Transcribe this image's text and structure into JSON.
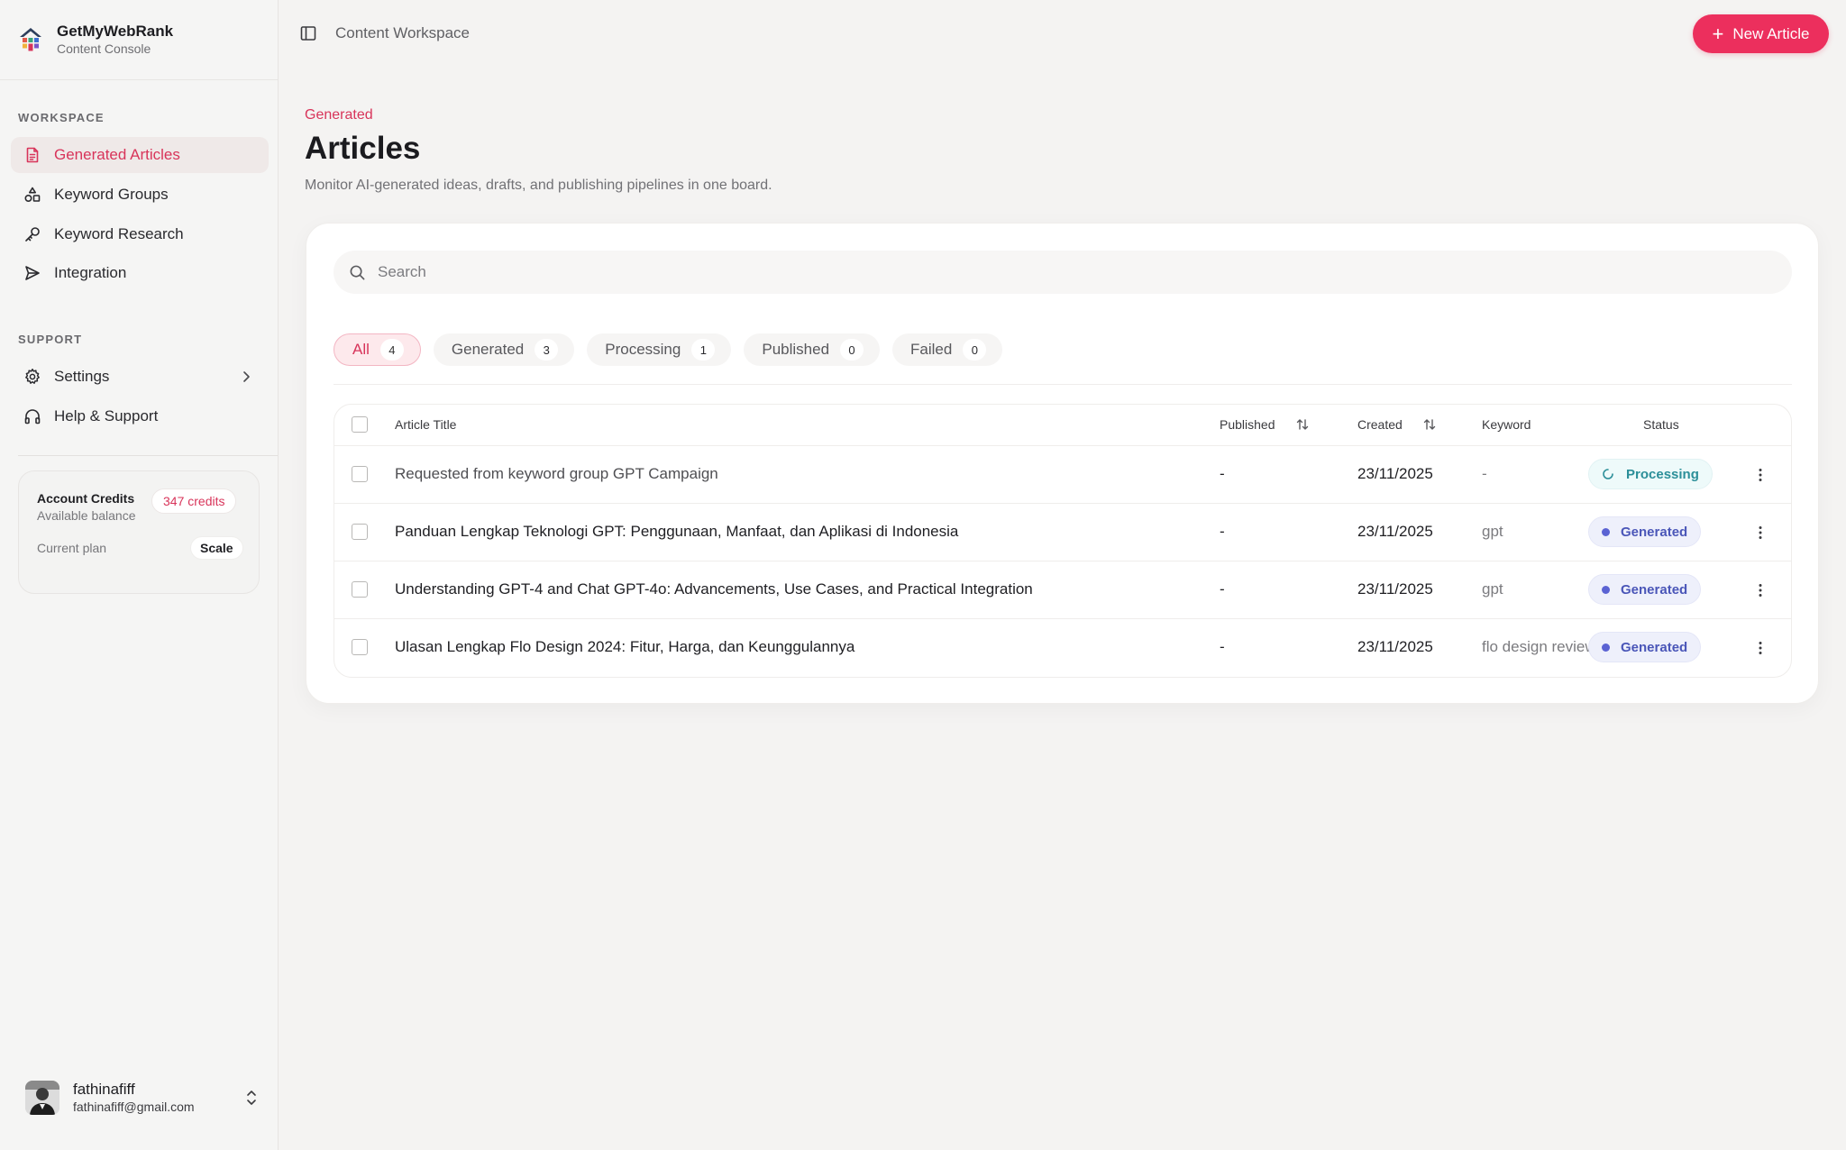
{
  "brand": {
    "name": "GetMyWebRank",
    "subtitle": "Content Console"
  },
  "sidebar": {
    "workspace_label": "WORKSPACE",
    "workspace_items": [
      {
        "label": "Generated Articles",
        "icon": "document-icon",
        "active": true
      },
      {
        "label": "Keyword Groups",
        "icon": "shapes-icon",
        "active": false
      },
      {
        "label": "Keyword Research",
        "icon": "key-icon",
        "active": false
      },
      {
        "label": "Integration",
        "icon": "send-icon",
        "active": false
      }
    ],
    "support_label": "SUPPORT",
    "support_items": [
      {
        "label": "Settings",
        "icon": "gear-icon",
        "has_chevron": true
      },
      {
        "label": "Help & Support",
        "icon": "headphones-icon",
        "has_chevron": false
      }
    ],
    "credits": {
      "title": "Account Credits",
      "subtitle": "Available balance",
      "badge": "347 credits",
      "plan_label": "Current plan",
      "plan_value": "Scale"
    },
    "user": {
      "name": "fathinafiff",
      "email": "fathinafiff@gmail.com"
    }
  },
  "topbar": {
    "title": "Content Workspace",
    "new_button": "New Article"
  },
  "header": {
    "eyebrow": "Generated",
    "title": "Articles",
    "description": "Monitor AI-generated ideas, drafts, and publishing pipelines in one board."
  },
  "search": {
    "placeholder": "Search",
    "value": ""
  },
  "tabs": [
    {
      "label": "All",
      "count": "4",
      "active": true
    },
    {
      "label": "Generated",
      "count": "3",
      "active": false
    },
    {
      "label": "Processing",
      "count": "1",
      "active": false
    },
    {
      "label": "Published",
      "count": "0",
      "active": false
    },
    {
      "label": "Failed",
      "count": "0",
      "active": false
    }
  ],
  "table": {
    "columns": {
      "title": "Article Title",
      "published": "Published",
      "created": "Created",
      "keyword": "Keyword",
      "status": "Status"
    },
    "rows": [
      {
        "title": "Requested from keyword group GPT Campaign",
        "published": "-",
        "created": "23/11/2025",
        "keyword": "-",
        "status": "Processing"
      },
      {
        "title": "Panduan Lengkap Teknologi GPT: Penggunaan, Manfaat, dan Aplikasi di Indonesia",
        "published": "-",
        "created": "23/11/2025",
        "keyword": "gpt",
        "status": "Generated"
      },
      {
        "title": "Understanding GPT-4 and Chat GPT-4o: Advancements, Use Cases, and Practical Integration",
        "published": "-",
        "created": "23/11/2025",
        "keyword": "gpt",
        "status": "Generated"
      },
      {
        "title": "Ulasan Lengkap Flo Design 2024: Fitur, Harga, dan Keunggulannya",
        "published": "-",
        "created": "23/11/2025",
        "keyword": "flo design reviews",
        "status": "Generated"
      }
    ]
  },
  "colors": {
    "accent": "#ec2f5d",
    "accent_text": "#d8345a",
    "generated": "#4a56b8",
    "processing": "#2c8f99"
  }
}
